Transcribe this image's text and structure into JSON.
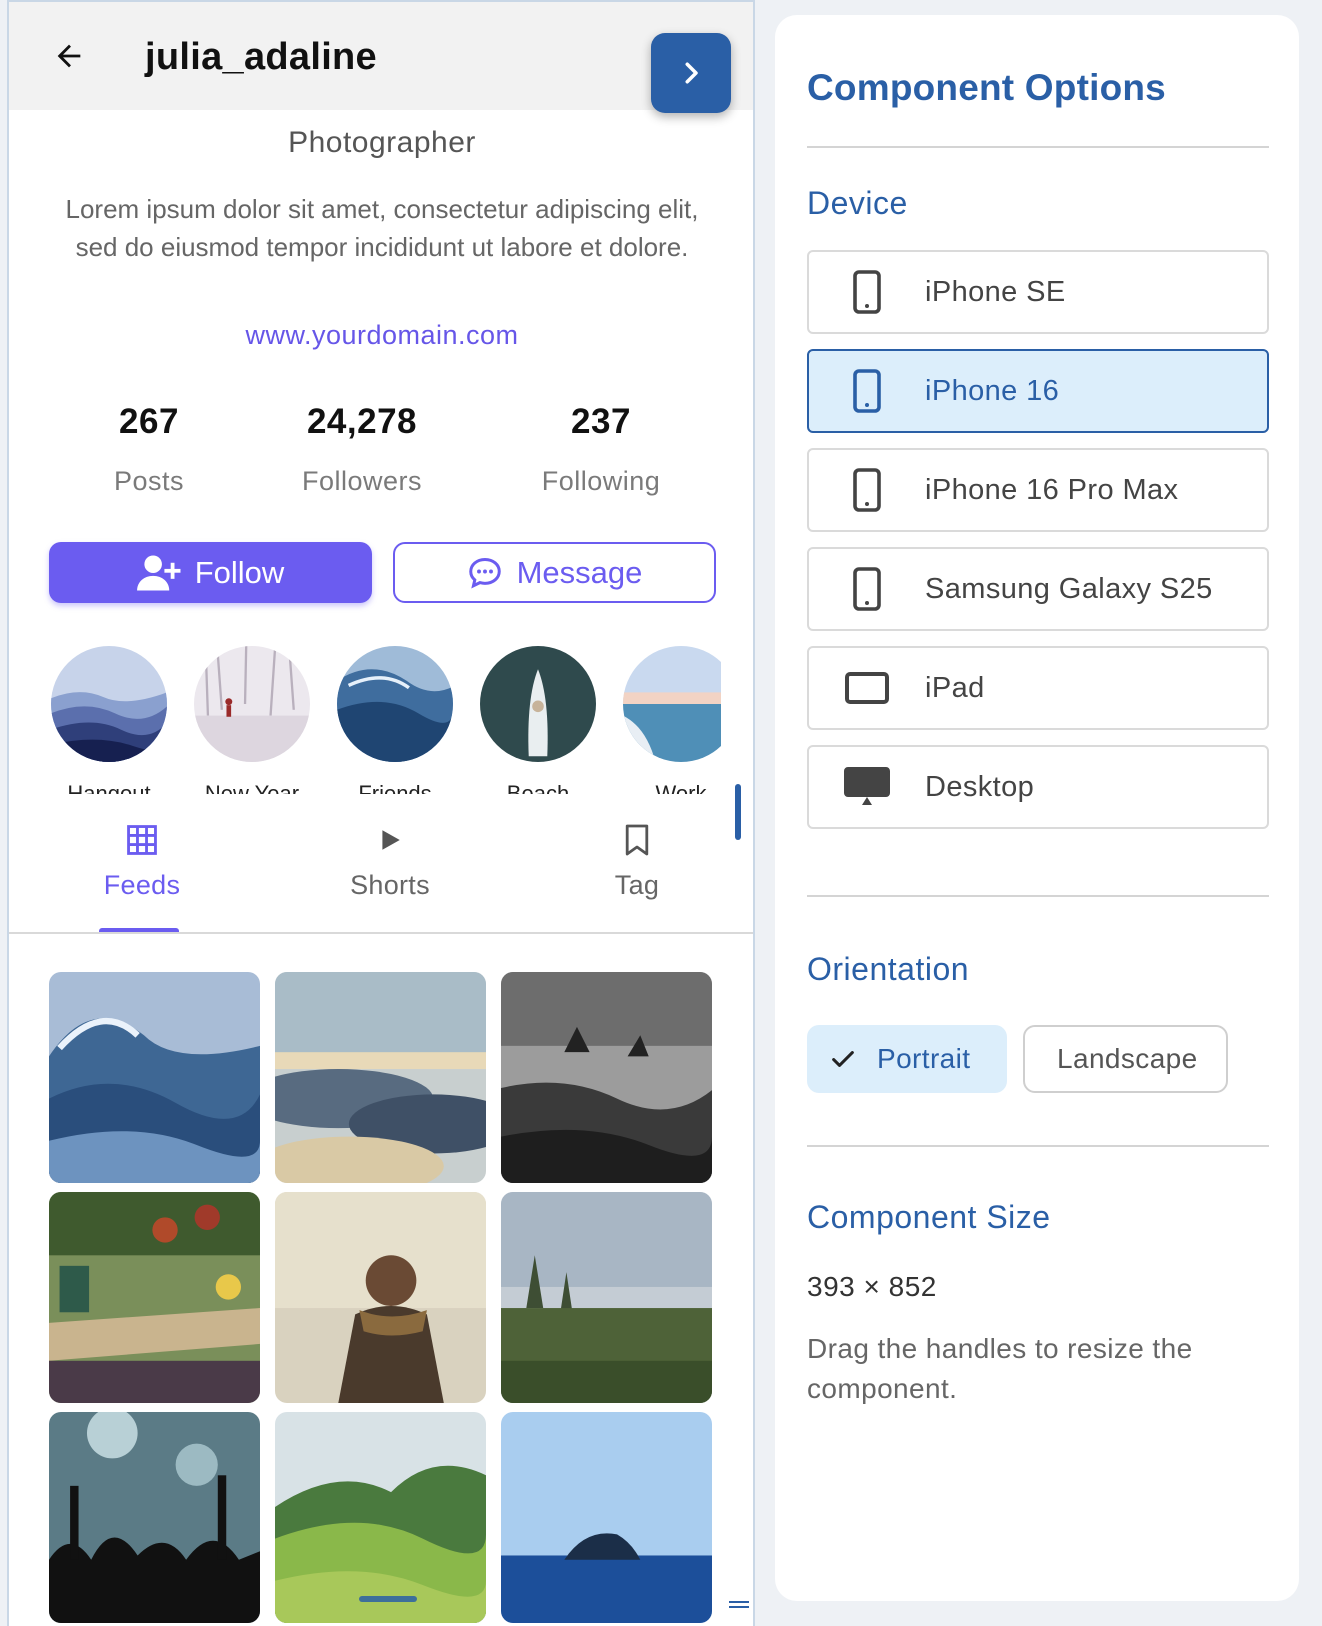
{
  "profile": {
    "username": "julia_adaline",
    "role": "Photographer",
    "bio": "Lorem ipsum dolor sit amet, consectetur adipiscing elit, sed do eiusmod tempor incididunt ut labore et dolore.",
    "website": "www.yourdomain.com",
    "stats": [
      {
        "value": "267",
        "label": "Posts"
      },
      {
        "value": "24,278",
        "label": "Followers"
      },
      {
        "value": "237",
        "label": "Following"
      }
    ],
    "follow_label": "Follow",
    "message_label": "Message",
    "stories": [
      {
        "label": "Hangout",
        "icon": "mountains-photo"
      },
      {
        "label": "New Year",
        "icon": "snowy-forest-photo"
      },
      {
        "label": "Friends",
        "icon": "wave-photo"
      },
      {
        "label": "Beach",
        "icon": "boat-aerial-photo"
      },
      {
        "label": "Work",
        "icon": "sea-horizon-photo"
      }
    ],
    "tabs": [
      {
        "label": "Feeds",
        "icon": "grid-icon",
        "active": true
      },
      {
        "label": "Shorts",
        "icon": "play-icon",
        "active": false
      },
      {
        "label": "Tag",
        "icon": "bookmark-icon",
        "active": false
      }
    ],
    "posts": [
      "ocean-wave-photo",
      "clouds-above-photo",
      "rocky-coast-photo",
      "cafe-interior-photo",
      "woman-scarf-photo",
      "meadow-trees-photo",
      "concert-crowd-photo",
      "green-hills-photo",
      "island-sea-photo"
    ]
  },
  "options": {
    "title": "Component Options",
    "device_section": "Device",
    "devices": [
      {
        "label": "iPhone SE",
        "icon": "phone-icon",
        "selected": false
      },
      {
        "label": "iPhone 16",
        "icon": "phone-icon",
        "selected": true
      },
      {
        "label": "iPhone 16 Pro Max",
        "icon": "phone-icon",
        "selected": false
      },
      {
        "label": "Samsung Galaxy S25",
        "icon": "phone-icon",
        "selected": false
      },
      {
        "label": "iPad",
        "icon": "tablet-icon",
        "selected": false
      },
      {
        "label": "Desktop",
        "icon": "desktop-icon",
        "selected": false
      }
    ],
    "orientation_section": "Orientation",
    "orientation": {
      "portrait": "Portrait",
      "landscape": "Landscape",
      "selected": "portrait"
    },
    "size_section": "Component Size",
    "size_value": "393 × 852",
    "size_help": "Drag the handles to resize the component."
  },
  "colors": {
    "accent_purple": "#6b5cf0",
    "accent_blue": "#2a5fa6",
    "selected_bg": "#dceefb"
  }
}
